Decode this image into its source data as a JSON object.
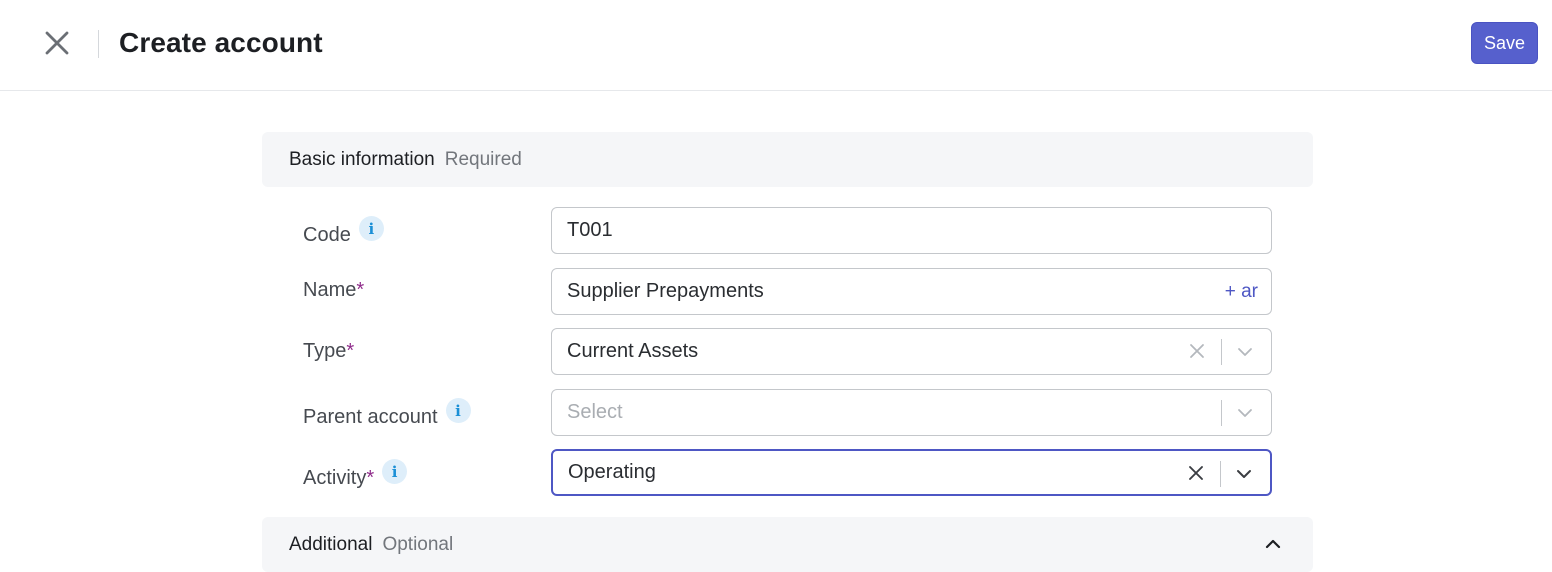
{
  "header": {
    "title": "Create account",
    "save_label": "Save",
    "close_icon": "close-icon"
  },
  "sections": {
    "basic": {
      "title": "Basic information",
      "subtitle": "Required"
    },
    "additional": {
      "title": "Additional",
      "subtitle": "Optional"
    }
  },
  "fields": {
    "code": {
      "label": "Code",
      "value": "T001",
      "info_icon": "info-icon"
    },
    "name": {
      "label": "Name",
      "required_mark": "*",
      "value": "Supplier Prepayments",
      "addon": "+ ar"
    },
    "type": {
      "label": "Type",
      "required_mark": "*",
      "value": "Current Assets"
    },
    "parent": {
      "label": "Parent account",
      "placeholder": "Select",
      "info_icon": "info-icon"
    },
    "activity": {
      "label": "Activity",
      "required_mark": "*",
      "value": "Operating",
      "info_icon": "info-icon"
    }
  },
  "colors": {
    "accent": "#5660cd",
    "required": "#8e2a8a",
    "info": "#1a8fd6"
  }
}
